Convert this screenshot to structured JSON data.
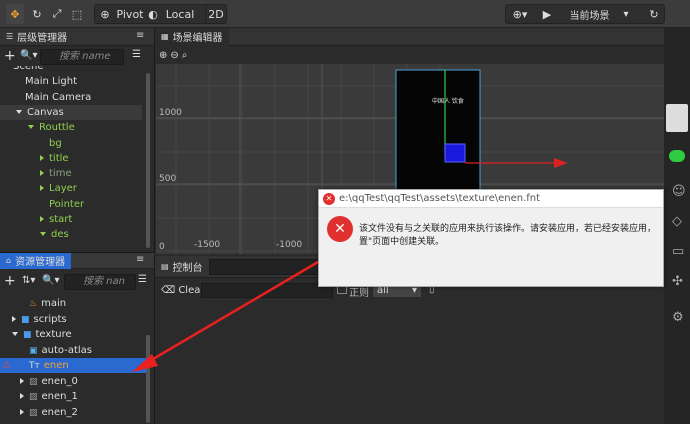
{
  "toolbar": {
    "pivot_label": "Pivot",
    "local_label": "Local",
    "mode_2d": "2D",
    "scene_select": "当前场景"
  },
  "hierarchy": {
    "title": "层级管理器",
    "search_placeholder": "搜索 name",
    "items": [
      {
        "label": "Scene",
        "color": "white",
        "indent": 0,
        "arrow": "none"
      },
      {
        "label": "Main Light",
        "color": "white",
        "indent": 1,
        "arrow": "none"
      },
      {
        "label": "Main Camera",
        "color": "white",
        "indent": 1,
        "arrow": "none"
      },
      {
        "label": "Canvas",
        "color": "white",
        "indent": 1,
        "arrow": "down"
      },
      {
        "label": "Routtle",
        "color": "green",
        "indent": 2,
        "arrow": "down"
      },
      {
        "label": "bg",
        "color": "green",
        "indent": 3,
        "arrow": "none"
      },
      {
        "label": "title",
        "color": "green",
        "indent": 3,
        "arrow": "right"
      },
      {
        "label": "time",
        "color": "grey",
        "indent": 3,
        "arrow": "right"
      },
      {
        "label": "Layer",
        "color": "green",
        "indent": 3,
        "arrow": "right"
      },
      {
        "label": "Pointer",
        "color": "green",
        "indent": 3,
        "arrow": "none"
      },
      {
        "label": "start",
        "color": "green",
        "indent": 3,
        "arrow": "right"
      },
      {
        "label": "des",
        "color": "green",
        "indent": 3,
        "arrow": "down"
      }
    ]
  },
  "assets": {
    "title": "资源管理器",
    "search_placeholder": "搜索 nan",
    "items": [
      {
        "label": "main",
        "indent": 2,
        "arrow": "none",
        "icon": "fire-icon"
      },
      {
        "label": "scripts",
        "indent": 1,
        "arrow": "right",
        "icon": "folder-icon"
      },
      {
        "label": "texture",
        "indent": 1,
        "arrow": "down",
        "icon": "folder-icon"
      },
      {
        "label": "auto-atlas",
        "indent": 2,
        "arrow": "none",
        "icon": "atlas-icon"
      },
      {
        "label": "enen",
        "indent": 2,
        "arrow": "none",
        "icon": "font-icon",
        "selected": true
      },
      {
        "label": "enen_0",
        "indent": 2,
        "arrow": "right",
        "icon": "image-icon"
      },
      {
        "label": "enen_1",
        "indent": 2,
        "arrow": "right",
        "icon": "image-icon"
      },
      {
        "label": "enen_2",
        "indent": 2,
        "arrow": "right",
        "icon": "image-icon"
      }
    ]
  },
  "scene": {
    "title": "场景编辑器",
    "y_labels": [
      "1000",
      "500",
      "0"
    ],
    "x_labels": [
      "-1500",
      "-1000"
    ],
    "canvas_text": "中国人 饮食"
  },
  "dialog": {
    "title": "e:\\qqTest\\qqTest\\assets\\texture\\enen.fnt",
    "line1": "该文件没有与之关联的应用来执行该操作。请安装应用，若已经安装应用，",
    "line2": "置\"页面中创建关联。"
  },
  "console": {
    "title": "控制台",
    "clear_label": "Clear",
    "regex_label": "正则",
    "filter_value": "all"
  },
  "colors": {
    "accent_blue": "#2a6ad0",
    "error_red": "#e03030",
    "node_green": "#8fd14f"
  }
}
